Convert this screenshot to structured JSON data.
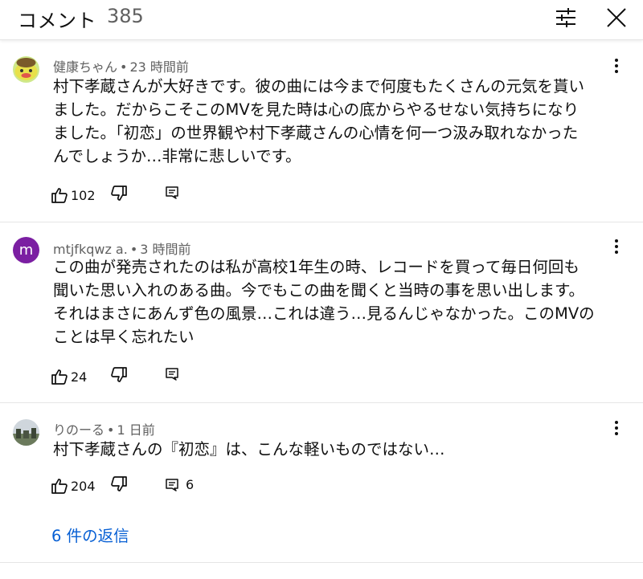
{
  "header": {
    "title": "コメント",
    "count": "385"
  },
  "comments": [
    {
      "author": "健康ちゃん",
      "time": "23 時間前",
      "lines": [
        "村下孝蔵さんが大好きです。彼の曲には今まで何度もたくさんの元気を貰い",
        "ました。だからこそこのMVを見た時は心の底からやるせない気持ちになり",
        "ました。「初恋」の世界観や村下孝蔵さんの心情を何一つ汲み取れなかった",
        "んでしょうか…非常に悲しいです。"
      ],
      "likes": "102",
      "reply_count": ""
    },
    {
      "author": "mtjfkqwz a.",
      "avatar_letter": "m",
      "time": "3 時間前",
      "lines": [
        "この曲が発売されたのは私が高校1年生の時、レコードを買って毎日何回も",
        "聞いた思い入れのある曲。今でもこの曲を聞くと当時の事を思い出します。",
        "それはまさにあんず色の風景…これは違う…見るんじゃなかった。このMVの",
        "ことは早く忘れたい"
      ],
      "likes": "24",
      "reply_count": ""
    },
    {
      "author": "りのーる",
      "time": "1 日前",
      "lines": [
        "村下孝蔵さんの『初恋』は、こんな軽いものではない…"
      ],
      "likes": "204",
      "reply_count": "6"
    }
  ],
  "replies_link": "6 件の返信",
  "colors": {
    "link": "#065fd4",
    "meta": "#606060",
    "avatar_m": "#7b1fa2"
  }
}
